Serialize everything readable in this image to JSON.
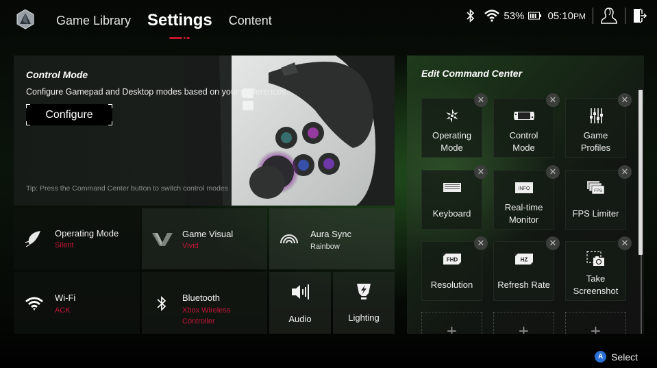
{
  "nav": {
    "tabs": [
      {
        "label": "Game Library",
        "active": false
      },
      {
        "label": "Settings",
        "active": true
      },
      {
        "label": "Content",
        "active": false
      }
    ]
  },
  "status": {
    "icons": [
      "bluetooth-icon",
      "wifi-icon",
      "battery-icon"
    ],
    "battery_percent": "53%",
    "time": "05:10",
    "ampm": "PM",
    "account_icon": "user-profile-icon",
    "exit_icon": "exit-icon"
  },
  "control_mode": {
    "title": "Control Mode",
    "description": "Configure Gamepad and Desktop modes based on your preferences.",
    "button_label": "Configure",
    "tip": "Tip: Press the Command Center button to switch control modes"
  },
  "quick_settings": [
    {
      "name": "Operating Mode",
      "value": "Silent",
      "icon": "leaf-icon"
    },
    {
      "name": "Game Visual",
      "value": "Vivid",
      "icon": "game-visual-icon"
    },
    {
      "name": "Aura Sync",
      "value": "Rainbow",
      "icon": "aura-sync-icon"
    },
    {
      "name": "Wi-Fi",
      "value": "ACK",
      "icon": "wifi-icon"
    },
    {
      "name": "Bluetooth",
      "value": "Xbox Wireless Controller",
      "value_line1": "Xbox Wireless",
      "value_line2": "Controller",
      "icon": "bluetooth-icon"
    },
    {
      "name": "Audio",
      "icon": "speaker-icon"
    },
    {
      "name": "Lighting",
      "icon": "lighting-icon"
    }
  ],
  "command_center": {
    "title": "Edit Command Center",
    "items": [
      {
        "label_line1": "Operating",
        "label_line2": "Mode",
        "icon": "operating-mode-icon"
      },
      {
        "label_line1": "Control",
        "label_line2": "Mode",
        "icon": "handheld-device-icon"
      },
      {
        "label_line1": "Game",
        "label_line2": "Profiles",
        "icon": "sliders-icon"
      },
      {
        "label_line1": "Keyboard",
        "label_line2": "",
        "icon": "keyboard-icon"
      },
      {
        "label_line1": "Real-time",
        "label_line2": "Monitor",
        "icon": "info-monitor-icon"
      },
      {
        "label_line1": "FPS Limiter",
        "label_line2": "",
        "icon": "fps-icon"
      },
      {
        "label_line1": "Resolution",
        "label_line2": "",
        "icon": "fhd-resolution-icon"
      },
      {
        "label_line1": "Refresh Rate",
        "label_line2": "",
        "icon": "hz-refresh-icon"
      },
      {
        "label_line1": "Take",
        "label_line2": "Screenshot",
        "icon": "screenshot-icon"
      }
    ],
    "close_glyph": "✕",
    "add_glyph": "+",
    "empty_slots": 3
  },
  "footer": {
    "button_glyph": "A",
    "hint_label": "Select"
  },
  "colors": {
    "accent_red": "#c8153a",
    "button_blue": "#2a6fd6"
  }
}
